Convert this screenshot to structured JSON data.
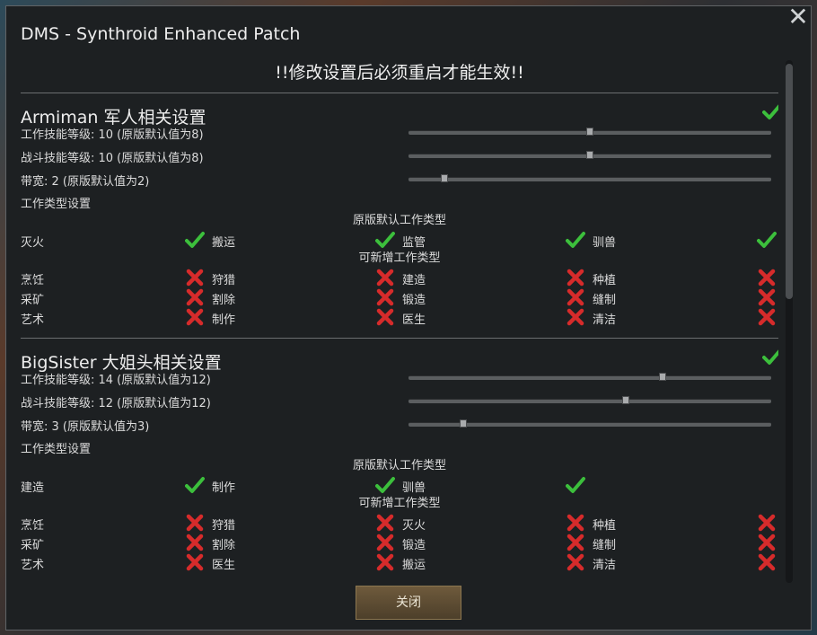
{
  "window": {
    "title": "DMS - Synthroid Enhanced Patch",
    "close_glyph": "✕",
    "warning": "!!修改设置后必须重启才能生效!!",
    "close_button_label": "关闭"
  },
  "colors": {
    "check": "#3cbf3c",
    "cross": "#d62b2b",
    "button": "#5e4c33"
  },
  "sections": [
    {
      "title": "Armiman 军人相关设置",
      "enabled": true,
      "sliders": [
        {
          "label": "工作技能等级: 10 (原版默认值为8)",
          "value": 10,
          "min": 0,
          "max": 20
        },
        {
          "label": "战斗技能等级: 10 (原版默认值为8)",
          "value": 10,
          "min": 0,
          "max": 20
        },
        {
          "label": "带宽: 2 (原版默认值为2)",
          "value": 2,
          "min": 0,
          "max": 20
        }
      ],
      "work_type_heading": "工作类型设置",
      "default_caption": "原版默认工作类型",
      "default_row": [
        {
          "label": "灭火",
          "enabled": true
        },
        {
          "label": "搬运",
          "enabled": true
        },
        {
          "label": "监管",
          "enabled": true
        },
        {
          "label": "驯兽",
          "enabled": true
        }
      ],
      "extra_caption": "可新增工作类型",
      "extra_rows": [
        [
          {
            "label": "烹饪",
            "enabled": false
          },
          {
            "label": "狩猎",
            "enabled": false
          },
          {
            "label": "建造",
            "enabled": false
          },
          {
            "label": "种植",
            "enabled": false
          }
        ],
        [
          {
            "label": "采矿",
            "enabled": false
          },
          {
            "label": "割除",
            "enabled": false
          },
          {
            "label": "锻造",
            "enabled": false
          },
          {
            "label": "缝制",
            "enabled": false
          }
        ],
        [
          {
            "label": "艺术",
            "enabled": false
          },
          {
            "label": "制作",
            "enabled": false
          },
          {
            "label": "医生",
            "enabled": false
          },
          {
            "label": "清洁",
            "enabled": false
          }
        ]
      ]
    },
    {
      "title": "BigSister 大姐头相关设置",
      "enabled": true,
      "sliders": [
        {
          "label": "工作技能等级: 14 (原版默认值为12)",
          "value": 14,
          "min": 0,
          "max": 20
        },
        {
          "label": "战斗技能等级: 12 (原版默认值为12)",
          "value": 12,
          "min": 0,
          "max": 20
        },
        {
          "label": "带宽: 3 (原版默认值为3)",
          "value": 3,
          "min": 0,
          "max": 20
        }
      ],
      "work_type_heading": "工作类型设置",
      "default_caption": "原版默认工作类型",
      "default_row": [
        {
          "label": "建造",
          "enabled": true
        },
        {
          "label": "制作",
          "enabled": true
        },
        {
          "label": "驯兽",
          "enabled": true
        }
      ],
      "extra_caption": "可新增工作类型",
      "extra_rows": [
        [
          {
            "label": "烹饪",
            "enabled": false
          },
          {
            "label": "狩猎",
            "enabled": false
          },
          {
            "label": "灭火",
            "enabled": false
          },
          {
            "label": "种植",
            "enabled": false
          }
        ],
        [
          {
            "label": "采矿",
            "enabled": false
          },
          {
            "label": "割除",
            "enabled": false
          },
          {
            "label": "锻造",
            "enabled": false
          },
          {
            "label": "缝制",
            "enabled": false
          }
        ],
        [
          {
            "label": "艺术",
            "enabled": false
          },
          {
            "label": "医生",
            "enabled": false
          },
          {
            "label": "搬运",
            "enabled": false
          },
          {
            "label": "清洁",
            "enabled": false
          }
        ]
      ]
    }
  ]
}
